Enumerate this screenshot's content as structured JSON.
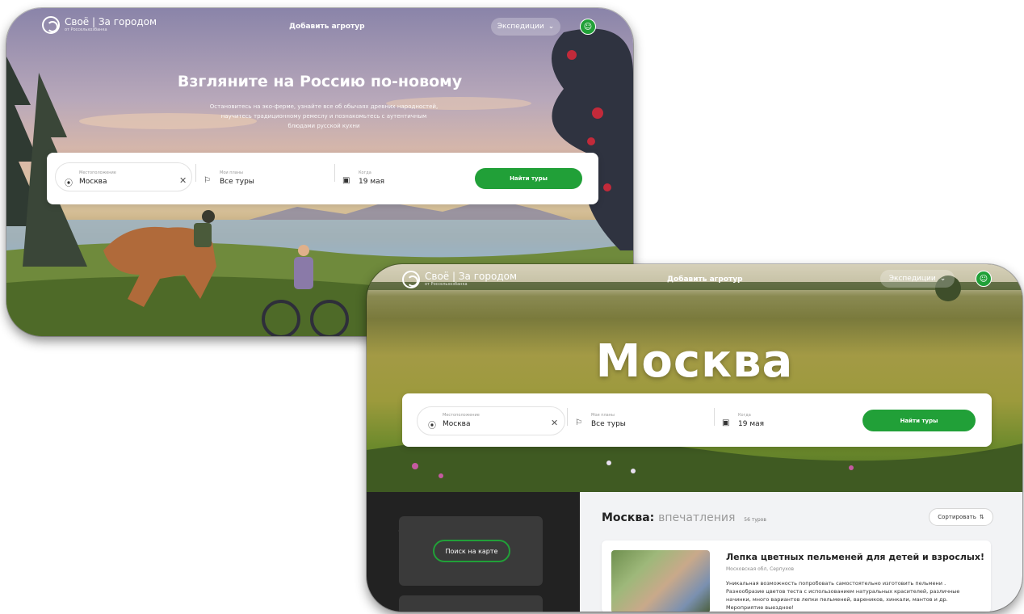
{
  "header": {
    "brand_main": "Своё | За городом",
    "brand_sub": "от Россельхозбанка",
    "add_tour_label": "Добавить агротур",
    "expeditions_label": "Экспедиции"
  },
  "home": {
    "title": "Взгляните на Россию по-новому",
    "subtitle": "Остановитесь на эко-ферме, узнайте все об обычаях древних народностей, научитесь традиционному ремеслу и познакомьтесь с аутентичным блюдами русской кухни"
  },
  "search": {
    "location_caption": "Местоположение",
    "location_value": "Москва",
    "plans_caption": "Мои планы",
    "plans_value": "Все туры",
    "date_caption": "Когда",
    "date_value": "19 мая",
    "find_button": "Найти туры"
  },
  "city_page": {
    "title": "Москва",
    "map_button": "Поиск на карте",
    "section_city": "Москва:",
    "section_category": "впечатления",
    "tour_count": "56 туров",
    "sort_label": "Сортировать",
    "card": {
      "title": "Лепка цветных пельменей для детей и взрослых!",
      "location": "Московская обл, Серпухов",
      "description": "Уникальная возможность попробовать самостоятельно изготовить пельмени . Разнообразие цветов теста с использованием натуральных красителей, различные начинки, много вариантов лепки пельменей, вареников, хинкали, мантов и др. Мероприятие выездное!"
    }
  },
  "colors": {
    "accent_green": "#21a038"
  }
}
